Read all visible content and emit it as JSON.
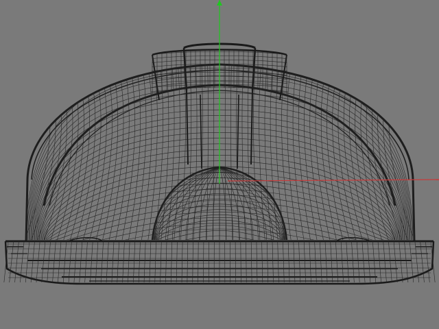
{
  "viewport": {
    "background_color": "#7a7a7a",
    "subject": "hard-hat-wireframe",
    "wire_color": "#1e1e1e",
    "axis_y_color": "#1ec81e",
    "axis_x_color": "#c83a3a"
  }
}
